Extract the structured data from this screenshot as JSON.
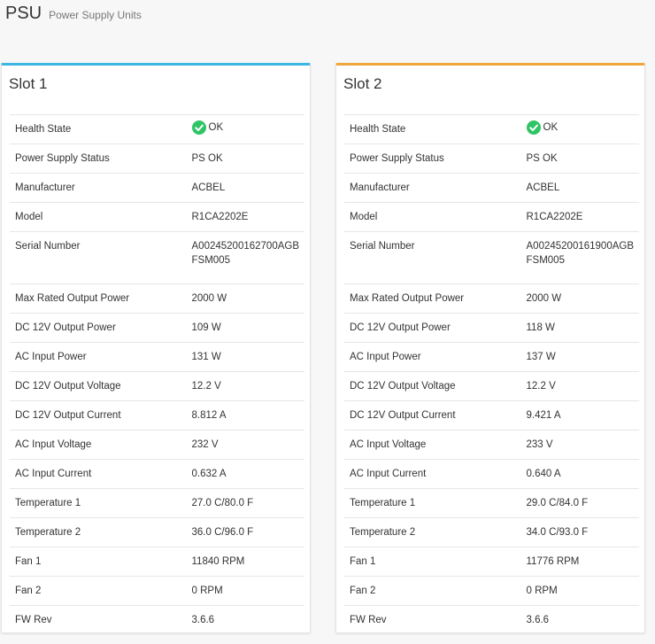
{
  "header": {
    "title": "PSU",
    "subtitle": "Power Supply Units"
  },
  "colors": {
    "slot1_accent": "#3cb6e3",
    "slot2_accent": "#f0a63a",
    "ok_green": "#2fc466"
  },
  "slots": [
    {
      "title": "Slot 1",
      "rows": [
        {
          "label": "Health State",
          "value": "OK",
          "icon": "check-circle-icon"
        },
        {
          "label": "Power Supply Status",
          "value": "PS OK"
        },
        {
          "label": "Manufacturer",
          "value": "ACBEL"
        },
        {
          "label": "Model",
          "value": "R1CA2202E"
        },
        {
          "label": "Serial Number",
          "value_line1": "A00245200162700AGB",
          "value_line2": "FSM005"
        },
        {
          "label": "Max Rated Output Power",
          "value": "2000 W"
        },
        {
          "label": "DC 12V Output Power",
          "value": "109 W"
        },
        {
          "label": "AC Input Power",
          "value": "131 W"
        },
        {
          "label": "DC 12V Output Voltage",
          "value": "12.2 V"
        },
        {
          "label": "DC 12V Output Current",
          "value": "8.812 A"
        },
        {
          "label": "AC Input Voltage",
          "value": "232 V"
        },
        {
          "label": "AC Input Current",
          "value": "0.632 A"
        },
        {
          "label": "Temperature 1",
          "value": "27.0 C/80.0 F"
        },
        {
          "label": "Temperature 2",
          "value": "36.0 C/96.0 F"
        },
        {
          "label": "Fan 1",
          "value": "11840 RPM"
        },
        {
          "label": "Fan 2",
          "value": "0 RPM"
        },
        {
          "label": "FW Rev",
          "value": "3.6.6"
        }
      ]
    },
    {
      "title": "Slot 2",
      "rows": [
        {
          "label": "Health State",
          "value": "OK",
          "icon": "check-circle-icon"
        },
        {
          "label": "Power Supply Status",
          "value": "PS OK"
        },
        {
          "label": "Manufacturer",
          "value": "ACBEL"
        },
        {
          "label": "Model",
          "value": "R1CA2202E"
        },
        {
          "label": "Serial Number",
          "value_line1": "A00245200161900AGB",
          "value_line2": "FSM005"
        },
        {
          "label": "Max Rated Output Power",
          "value": "2000 W"
        },
        {
          "label": "DC 12V Output Power",
          "value": "118 W"
        },
        {
          "label": "AC Input Power",
          "value": "137 W"
        },
        {
          "label": "DC 12V Output Voltage",
          "value": "12.2 V"
        },
        {
          "label": "DC 12V Output Current",
          "value": "9.421 A"
        },
        {
          "label": "AC Input Voltage",
          "value": "233 V"
        },
        {
          "label": "AC Input Current",
          "value": "0.640 A"
        },
        {
          "label": "Temperature 1",
          "value": "29.0 C/84.0 F"
        },
        {
          "label": "Temperature 2",
          "value": "34.0 C/93.0 F"
        },
        {
          "label": "Fan 1",
          "value": "11776 RPM"
        },
        {
          "label": "Fan 2",
          "value": "0 RPM"
        },
        {
          "label": "FW Rev",
          "value": "3.6.6"
        }
      ]
    }
  ]
}
